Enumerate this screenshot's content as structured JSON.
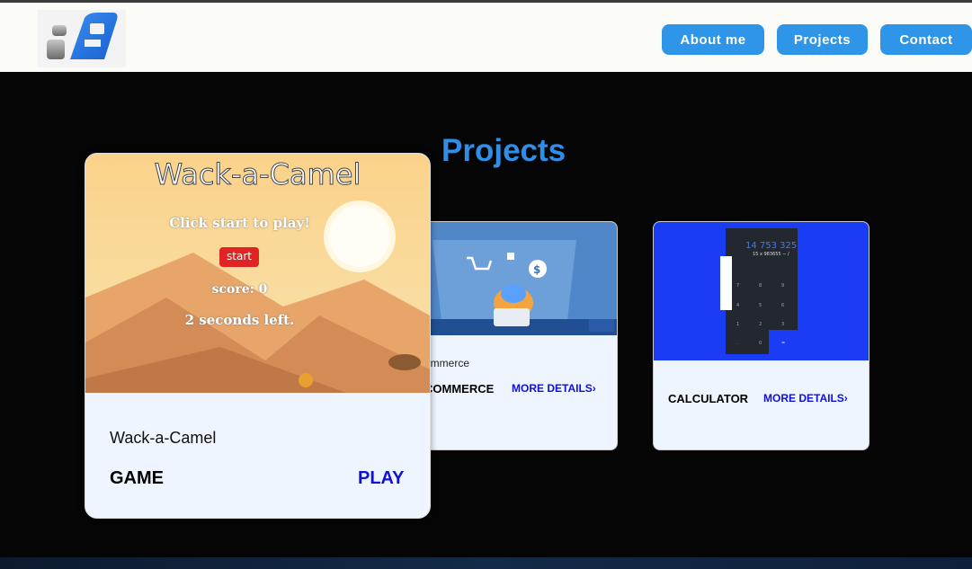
{
  "nav": {
    "about": "About me",
    "projects": "Projects",
    "contact": "Contact"
  },
  "main": {
    "title": "Projects"
  },
  "cards": [
    {
      "image_title": "Wack-a-Camel",
      "image_prompt": "Click start to play!",
      "image_start": "start",
      "image_score": "score: 0",
      "image_timer": "2 seconds left.",
      "description": "Wack-a-Camel",
      "category": "GAME",
      "link": "PLAY"
    },
    {
      "description": "ommerce",
      "category": "COMMERCE",
      "link": "MORE DETAILS›"
    },
    {
      "image_display": "14 753 325",
      "image_expr": "15 x 983655 − /",
      "category": "CALCULATOR",
      "link": "MORE DETAILS›"
    }
  ],
  "colors": {
    "accent": "#2f95e9",
    "link": "#1010d8",
    "calc_bg": "#1a3cf5"
  }
}
